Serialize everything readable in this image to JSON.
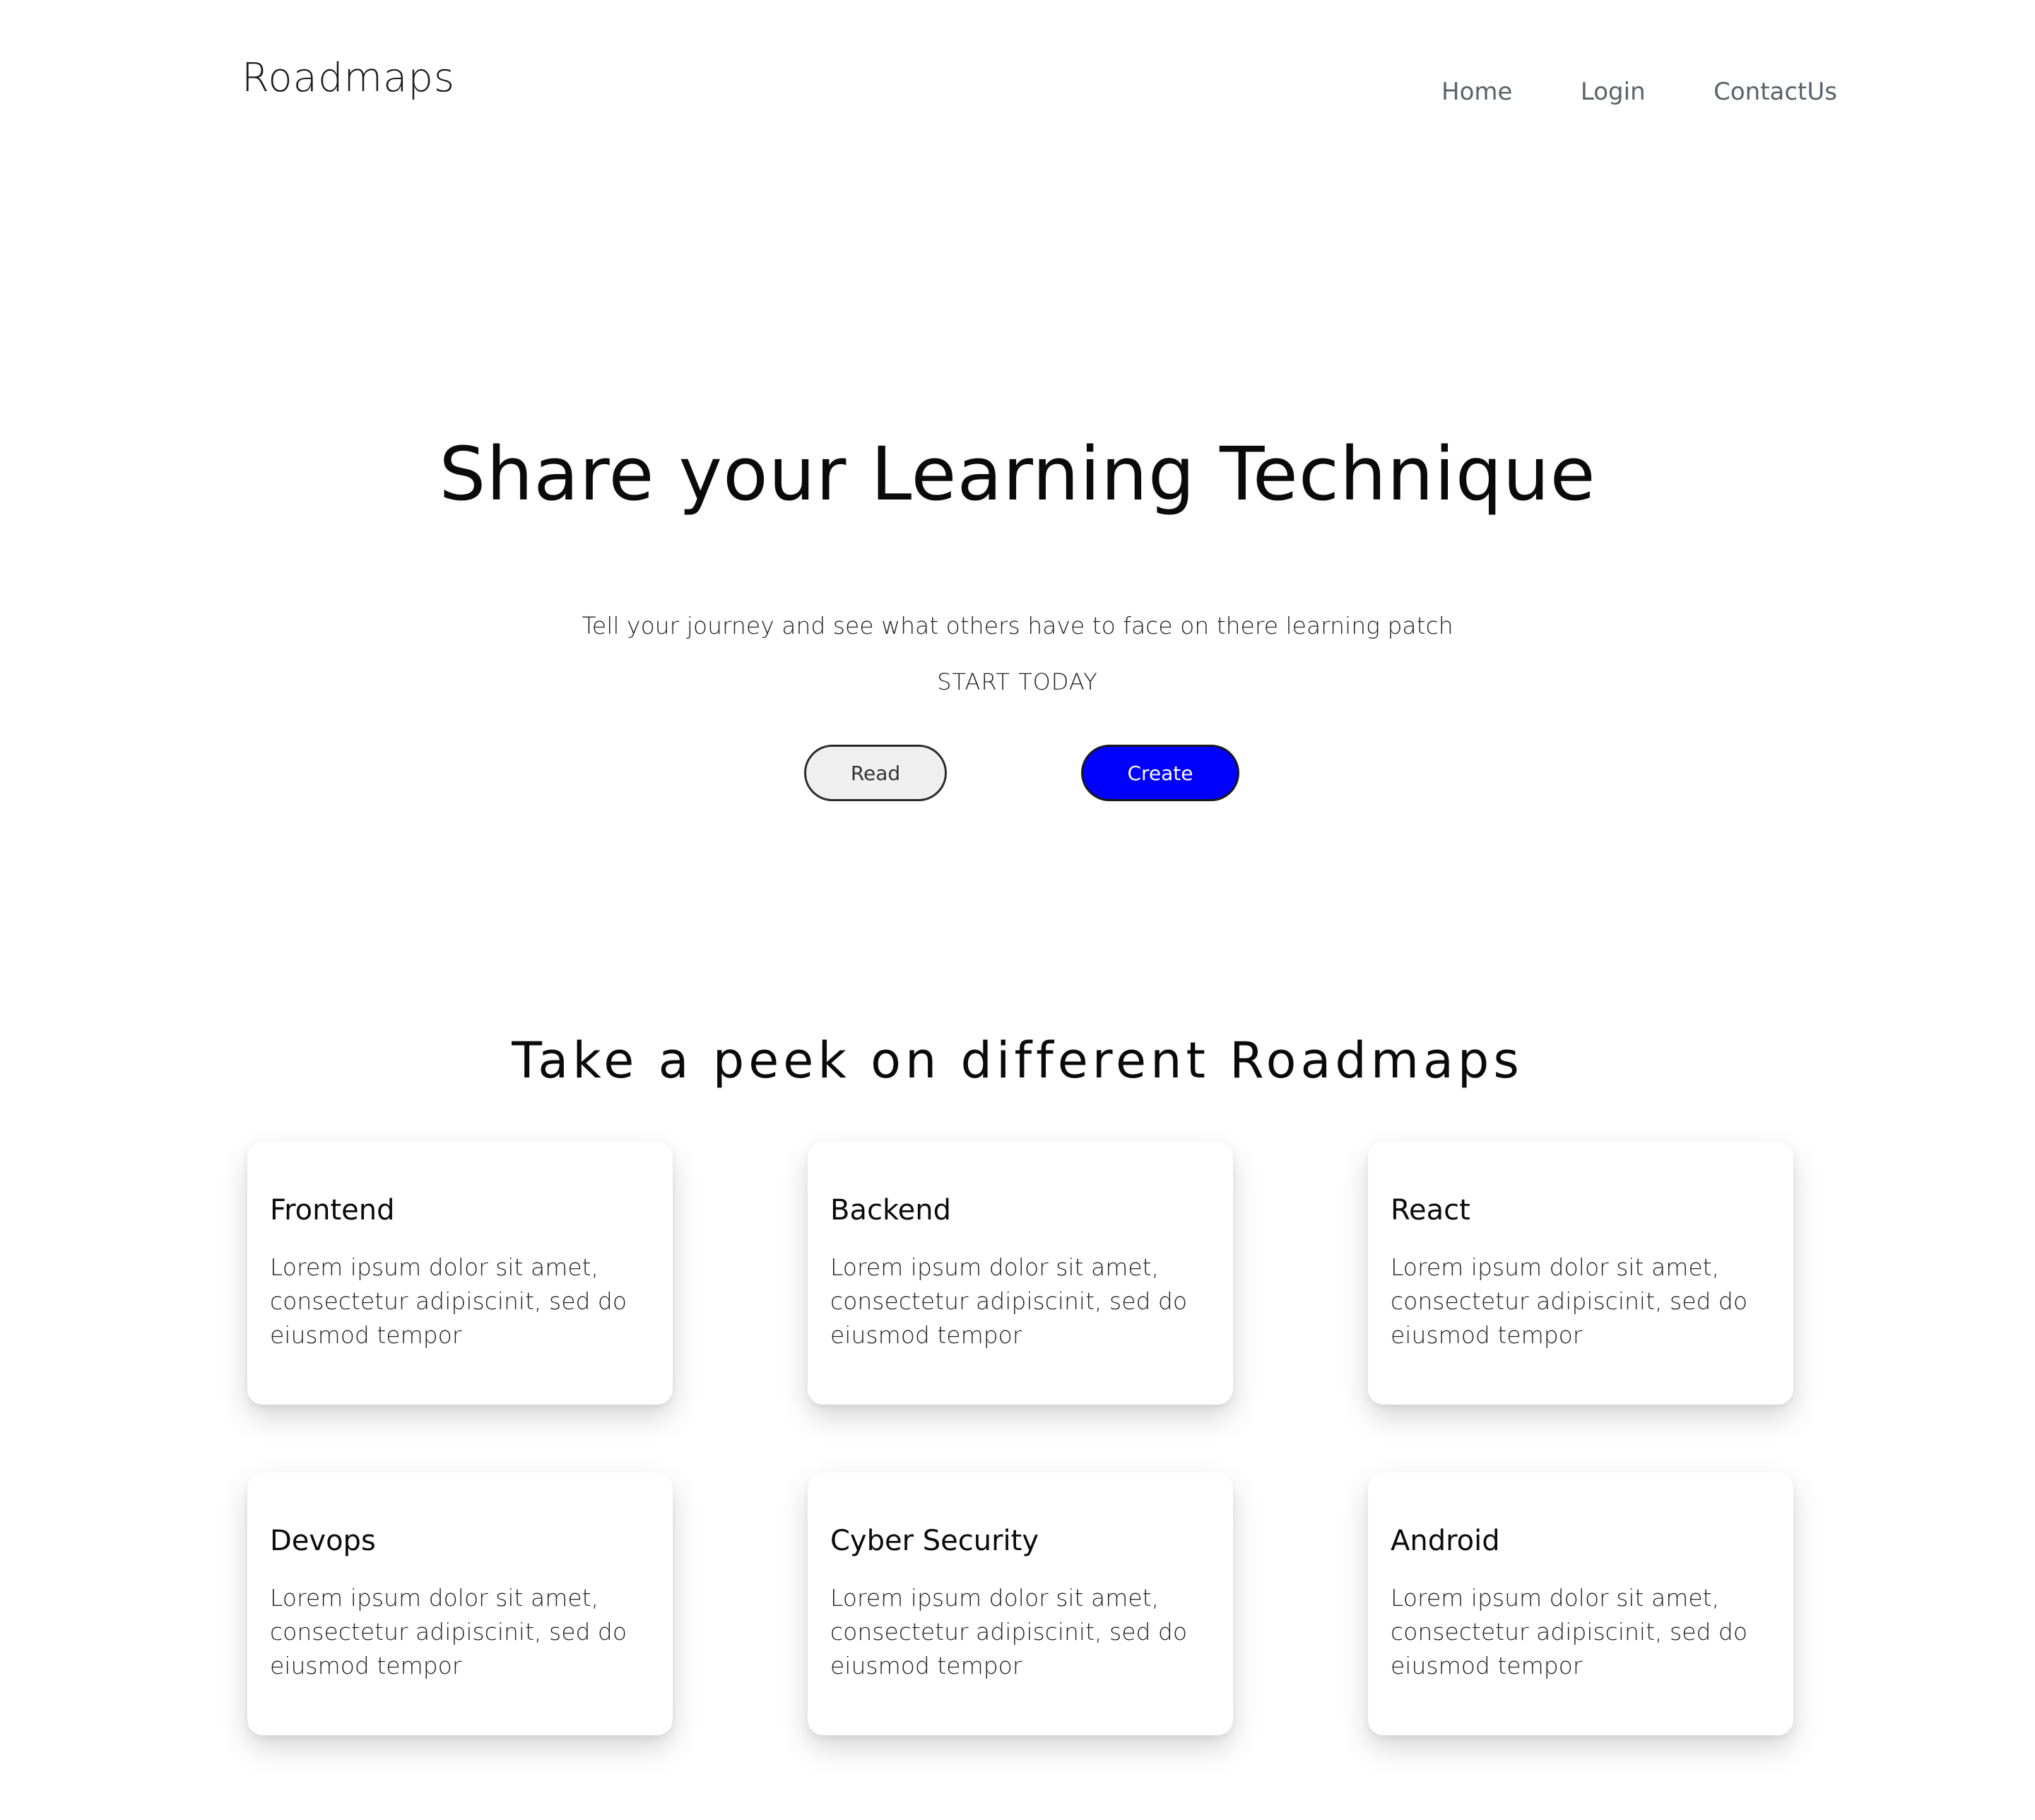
{
  "header": {
    "brand": "Roadmaps",
    "nav": {
      "home": "Home",
      "login": "Login",
      "contact": "ContactUs"
    }
  },
  "hero": {
    "title": "Share your Learning Technique",
    "subtitle": "Tell your journey and see what others have to face on there learning patch",
    "cta_label": "START TODAY",
    "read_label": "Read",
    "create_label": "Create"
  },
  "roadmaps": {
    "title": "Take a peek on different Roadmaps",
    "cards": [
      {
        "title": "Frontend",
        "body": "Lorem ipsum dolor sit amet, consectetur adipiscinit, sed do eiusmod tempor"
      },
      {
        "title": "Backend",
        "body": "Lorem ipsum dolor sit amet, consectetur adipiscinit, sed do eiusmod tempor"
      },
      {
        "title": "React",
        "body": "Lorem ipsum dolor sit amet, consectetur adipiscinit, sed do eiusmod tempor"
      },
      {
        "title": "Devops",
        "body": "Lorem ipsum dolor sit amet, consectetur adipiscinit, sed do eiusmod tempor"
      },
      {
        "title": "Cyber Security",
        "body": "Lorem ipsum dolor sit amet, consectetur adipiscinit, sed do eiusmod tempor"
      },
      {
        "title": "Android",
        "body": "Lorem ipsum dolor sit amet, consectetur adipiscinit, sed do eiusmod tempor"
      }
    ]
  },
  "colors": {
    "create_button": "#0000ff",
    "read_button": "#efefef",
    "nav_text": "#5a6266"
  }
}
